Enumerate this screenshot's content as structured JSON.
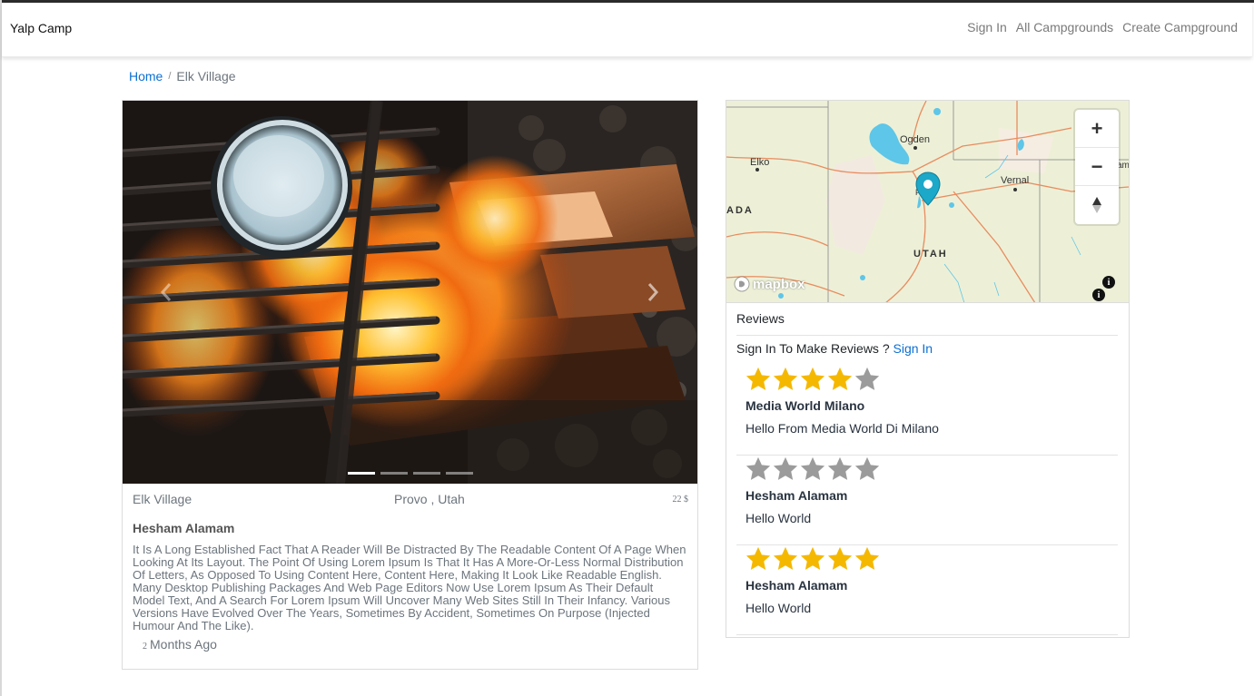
{
  "navbar": {
    "brand": "Yalp Camp",
    "links": [
      "Sign In",
      "All Campgrounds",
      "Create Campground"
    ]
  },
  "breadcrumb": {
    "home": "Home",
    "separator": "/",
    "current": "Elk Village"
  },
  "campground": {
    "name": "Elk Village",
    "location": "Provo , Utah",
    "price_amount": "22",
    "price_currency": "$",
    "author": "Hesham Alamam",
    "description": "It Is A Long Established Fact That A Reader Will Be Distracted By The Readable Content Of A Page When Looking At Its Layout. The Point Of Using Lorem Ipsum Is That It Has A More-Or-Less Normal Distribution Of Letters, As Opposed To Using Content Here, Content Here, Making It Look Like Readable English. Many Desktop Publishing Packages And Web Page Editors Now Use Lorem Ipsum As Their Default Model Text, And A Search For Lorem Ipsum Will Uncover Many Web Sites Still In Their Infancy. Various Versions Have Evolved Over The Years, Sometimes By Accident, Sometimes On Purpose (Injected Humour And The Like).",
    "posted_num": "2",
    "posted_unit": "Months Ago",
    "carousel": {
      "slide_count": 4,
      "active_index": 0,
      "prev_icon": "chevron-left-icon",
      "next_icon": "chevron-right-icon"
    }
  },
  "map": {
    "cities": [
      "Ogden",
      "Elko",
      "Vernal",
      "Provo"
    ],
    "state_label": "UTAH",
    "edge_label_left": "ADA",
    "edge_label_right": "am",
    "logo": "mapbox",
    "zoom_in": "+",
    "zoom_out": "−",
    "marker_icon": "map-pin-icon",
    "marker_color": "#1ba8c9"
  },
  "reviews": {
    "title": "Reviews",
    "signin_prompt": "Sign In To Make Reviews ?",
    "signin_link": "Sign In",
    "star_color": "#f5b800",
    "star_empty_color": "#9b9b9b",
    "items": [
      {
        "rating": 4,
        "author": "Media World Milano",
        "body": "Hello From Media World Di Milano"
      },
      {
        "rating": 0,
        "author": "Hesham Alamam",
        "body": "Hello World"
      },
      {
        "rating": 5,
        "author": "Hesham Alamam",
        "body": "Hello World"
      }
    ]
  }
}
